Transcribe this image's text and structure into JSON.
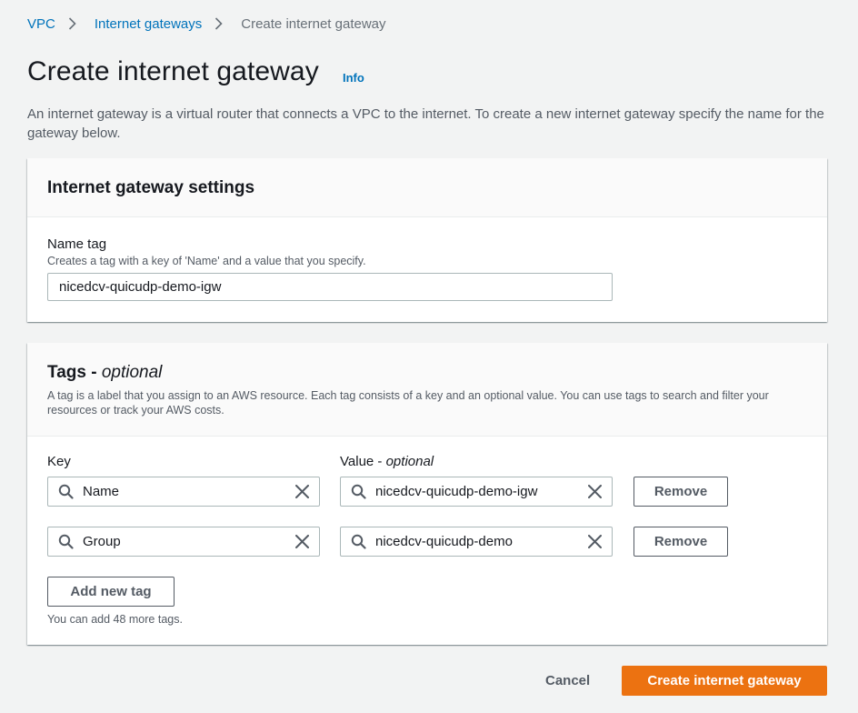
{
  "breadcrumb": {
    "items": [
      {
        "label": "VPC"
      },
      {
        "label": "Internet gateways"
      },
      {
        "label": "Create internet gateway"
      }
    ]
  },
  "header": {
    "title": "Create internet gateway",
    "info_label": "Info",
    "description": "An internet gateway is a virtual router that connects a VPC to the internet. To create a new internet gateway specify the name for the gateway below."
  },
  "settings": {
    "heading": "Internet gateway settings",
    "name_tag": {
      "label": "Name tag",
      "hint": "Creates a tag with a key of 'Name' and a value that you specify.",
      "value": "nicedcv-quicudp-demo-igw"
    }
  },
  "tags": {
    "heading": "Tags - ",
    "heading_optional": "optional",
    "description": "A tag is a label that you assign to an AWS resource. Each tag consists of a key and an optional value. You can use tags to search and filter your resources or track your AWS costs.",
    "key_label": "Key",
    "value_label": "Value - ",
    "value_label_optional": "optional",
    "rows": [
      {
        "key": "Name",
        "value": "nicedcv-quicudp-demo-igw",
        "remove_label": "Remove"
      },
      {
        "key": "Group",
        "value": "nicedcv-quicudp-demo",
        "remove_label": "Remove"
      }
    ],
    "add_label": "Add new tag",
    "remaining": "You can add 48 more tags."
  },
  "footer": {
    "cancel_label": "Cancel",
    "submit_label": "Create internet gateway"
  },
  "icons": {
    "separator": "chevron-right-icon",
    "search": "search-icon",
    "clear": "close-icon"
  },
  "colors": {
    "background": "#f2f3f3",
    "link": "#0073bb",
    "primary": "#ec7211",
    "text": "#16191f",
    "muted": "#545b64",
    "border": "#aab7b8"
  }
}
